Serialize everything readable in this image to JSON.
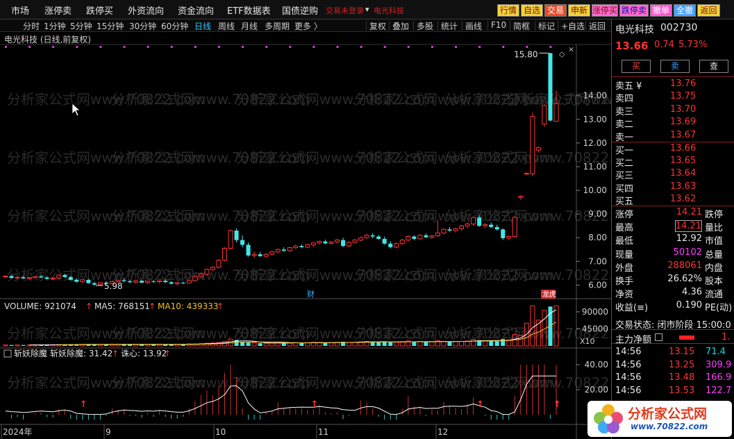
{
  "menu": {
    "items": [
      "市场",
      "涨停卖",
      "跌停买",
      "外资流向",
      "资金流向",
      "ETF数据表",
      "国债逆购"
    ],
    "trade_status": "交易未登录",
    "stock_name": "电光科技",
    "quick_buttons": [
      {
        "label": "行情",
        "bg": "#f2d33a",
        "fg": "#7a1010"
      },
      {
        "label": "自选",
        "bg": "#f2d33a",
        "fg": "#7a1010"
      },
      {
        "label": "交易",
        "bg": "#e84a2a",
        "fg": "#ffffff"
      },
      {
        "label": "申新",
        "bg": "#f2d33a",
        "fg": "#7a1010"
      },
      {
        "label": "涨停买",
        "bg": "#ff6ad0",
        "fg": "#7a1010"
      },
      {
        "label": "跌停卖",
        "bg": "#ff6ad0",
        "fg": "#1010aa"
      },
      {
        "label": "撤单",
        "bg": "#ff5ad2",
        "fg": "#ffffff"
      },
      {
        "label": "全撤",
        "bg": "#4aa0ff",
        "fg": "#ffffff"
      },
      {
        "label": "返回",
        "bg": "#f2d33a",
        "fg": "#7a1010"
      }
    ]
  },
  "toolbar": {
    "periods": [
      "分时",
      "1分钟",
      "5分钟",
      "15分钟",
      "30分钟",
      "60分钟",
      "日线",
      "周线",
      "月线",
      "多周期",
      "更多 〉"
    ],
    "active_period": "日线",
    "tools": [
      "复权",
      "叠加",
      "多股",
      "统计",
      "画线",
      "F10",
      "简框",
      "标记",
      "+自选",
      "返回"
    ]
  },
  "chart_title": "电光科技 (日线,前复权)",
  "chart_data": [
    {
      "type": "candlestick",
      "title": "电光科技 (日线,前复权)",
      "yaxis_ticks": [
        14.0,
        13.0,
        12.0,
        11.0,
        10.0,
        9.0,
        8.0,
        7.0,
        6.0
      ],
      "ylim": [
        5.6,
        15.9
      ],
      "xaxis_labels": [
        "2024年",
        "9",
        "10",
        "11",
        "12"
      ],
      "annotations": {
        "high_label": "15.80",
        "low_label": "5.98",
        "badges": [
          "财",
          "龙虎"
        ]
      },
      "candles": [
        [
          6.35,
          6.4,
          6.3,
          6.38
        ],
        [
          6.38,
          6.42,
          6.28,
          6.3
        ],
        [
          6.3,
          6.36,
          6.24,
          6.33
        ],
        [
          6.33,
          6.38,
          6.26,
          6.28
        ],
        [
          6.28,
          6.34,
          6.2,
          6.31
        ],
        [
          6.31,
          6.4,
          6.26,
          6.36
        ],
        [
          6.36,
          6.42,
          6.3,
          6.32
        ],
        [
          6.32,
          6.38,
          6.24,
          6.26
        ],
        [
          6.26,
          6.34,
          6.2,
          6.3
        ],
        [
          6.3,
          6.46,
          6.26,
          6.42
        ],
        [
          6.42,
          6.48,
          6.3,
          6.34
        ],
        [
          6.34,
          6.38,
          6.18,
          6.22
        ],
        [
          6.22,
          6.28,
          6.1,
          6.14
        ],
        [
          6.14,
          6.26,
          6.08,
          6.22
        ],
        [
          6.22,
          6.26,
          6.06,
          6.08
        ],
        [
          6.08,
          6.14,
          5.98,
          6.02
        ],
        [
          6.02,
          6.12,
          5.98,
          6.1
        ],
        [
          6.1,
          6.16,
          6.02,
          6.06
        ],
        [
          6.06,
          6.18,
          6.04,
          6.14
        ],
        [
          6.14,
          6.24,
          6.1,
          6.2
        ],
        [
          6.2,
          6.3,
          6.12,
          6.16
        ],
        [
          6.16,
          6.22,
          6.08,
          6.12
        ],
        [
          6.12,
          6.2,
          6.06,
          6.18
        ],
        [
          6.18,
          6.22,
          6.08,
          6.1
        ],
        [
          6.1,
          6.18,
          6.04,
          6.16
        ],
        [
          6.16,
          6.22,
          6.1,
          6.14
        ],
        [
          6.14,
          6.2,
          6.06,
          6.18
        ],
        [
          6.18,
          6.24,
          6.1,
          6.12
        ],
        [
          6.12,
          6.16,
          6.02,
          6.06
        ],
        [
          6.06,
          6.12,
          5.98,
          6.1
        ],
        [
          6.1,
          6.14,
          6.04,
          6.08
        ],
        [
          6.08,
          6.22,
          6.06,
          6.18
        ],
        [
          6.18,
          6.4,
          6.14,
          6.36
        ],
        [
          6.36,
          6.5,
          6.3,
          6.46
        ],
        [
          6.46,
          6.7,
          6.4,
          6.66
        ],
        [
          6.66,
          6.8,
          6.58,
          6.75
        ],
        [
          6.75,
          7.1,
          6.7,
          7.05
        ],
        [
          7.05,
          7.6,
          7.0,
          7.55
        ],
        [
          7.55,
          8.35,
          7.5,
          8.3
        ],
        [
          8.3,
          8.4,
          7.8,
          7.9
        ],
        [
          7.9,
          8.1,
          7.6,
          7.7
        ],
        [
          7.7,
          7.8,
          7.2,
          7.25
        ],
        [
          7.25,
          7.4,
          7.15,
          7.3
        ],
        [
          7.3,
          7.4,
          7.2,
          7.22
        ],
        [
          7.22,
          7.35,
          7.15,
          7.3
        ],
        [
          7.3,
          7.45,
          7.25,
          7.4
        ],
        [
          7.4,
          7.55,
          7.35,
          7.5
        ],
        [
          7.5,
          7.6,
          7.4,
          7.45
        ],
        [
          7.45,
          7.62,
          7.4,
          7.58
        ],
        [
          7.58,
          7.7,
          7.52,
          7.65
        ],
        [
          7.65,
          7.72,
          7.55,
          7.6
        ],
        [
          7.6,
          7.74,
          7.55,
          7.7
        ],
        [
          7.7,
          7.82,
          7.6,
          7.78
        ],
        [
          7.78,
          7.88,
          7.7,
          7.84
        ],
        [
          7.84,
          7.92,
          7.72,
          7.76
        ],
        [
          7.76,
          7.86,
          7.7,
          7.82
        ],
        [
          7.82,
          7.95,
          7.75,
          7.9
        ],
        [
          7.9,
          8.0,
          7.6,
          7.65
        ],
        [
          7.65,
          7.85,
          7.6,
          7.8
        ],
        [
          7.8,
          7.95,
          7.75,
          7.9
        ],
        [
          7.9,
          8.05,
          7.85,
          8.0
        ],
        [
          8.0,
          8.15,
          7.95,
          8.1
        ],
        [
          8.1,
          8.2,
          7.98,
          8.05
        ],
        [
          8.05,
          8.12,
          7.92,
          7.95
        ],
        [
          7.95,
          8.05,
          7.7,
          7.75
        ],
        [
          7.75,
          7.85,
          7.55,
          7.6
        ],
        [
          7.6,
          7.8,
          7.55,
          7.75
        ],
        [
          7.75,
          7.95,
          7.7,
          7.9
        ],
        [
          7.9,
          8.1,
          7.85,
          8.05
        ],
        [
          8.05,
          8.1,
          7.9,
          7.95
        ],
        [
          7.95,
          8.15,
          7.92,
          8.1
        ],
        [
          8.1,
          8.18,
          7.98,
          8.02
        ],
        [
          8.02,
          8.12,
          7.95,
          8.08
        ],
        [
          8.08,
          8.75,
          8.05,
          8.2
        ],
        [
          8.2,
          8.4,
          8.15,
          8.35
        ],
        [
          8.35,
          8.45,
          8.25,
          8.3
        ],
        [
          8.3,
          8.42,
          8.22,
          8.38
        ],
        [
          8.38,
          8.55,
          8.3,
          8.5
        ],
        [
          8.5,
          8.65,
          8.4,
          8.58
        ],
        [
          8.58,
          8.9,
          8.5,
          8.85
        ],
        [
          8.85,
          8.95,
          8.45,
          8.5
        ],
        [
          8.5,
          8.62,
          8.4,
          8.55
        ],
        [
          8.55,
          8.65,
          8.4,
          8.45
        ],
        [
          8.45,
          8.55,
          8.3,
          8.35
        ],
        [
          8.35,
          8.4,
          7.9,
          7.98
        ],
        [
          7.98,
          8.1,
          7.9,
          8.05
        ],
        [
          8.05,
          8.9,
          8.0,
          8.86
        ],
        [
          9.7,
          9.8,
          9.6,
          9.75
        ],
        [
          10.7,
          10.75,
          10.65,
          10.72
        ],
        [
          10.7,
          13.3,
          10.6,
          13.12
        ],
        [
          11.7,
          11.85,
          11.6,
          11.8
        ],
        [
          12.8,
          13.65,
          12.7,
          13.58
        ],
        [
          15.8,
          15.8,
          12.92,
          12.95
        ],
        [
          12.92,
          14.21,
          12.92,
          13.66
        ]
      ],
      "volume": {
        "label": "VOLUME: 921074",
        "ma5_label": "MA5: 768151",
        "ma10_label": "MA10: 439333",
        "ticks": [
          90000,
          45000
        ],
        "unit": "X10",
        "values": [
          25,
          25,
          25,
          25,
          25,
          30,
          30,
          30,
          30,
          35,
          40,
          40,
          40,
          40,
          40,
          40,
          40,
          40,
          40,
          40,
          40,
          40,
          40,
          40,
          40,
          40,
          40,
          40,
          40,
          40,
          40,
          55,
          55,
          60,
          70,
          80,
          90,
          120,
          180,
          160,
          110,
          90,
          80,
          75,
          70,
          80,
          85,
          75,
          80,
          90,
          85,
          85,
          95,
          90,
          80,
          85,
          95,
          110,
          90,
          95,
          110,
          120,
          115,
          100,
          110,
          95,
          100,
          115,
          130,
          110,
          115,
          105,
          110,
          135,
          120,
          110,
          115,
          120,
          130,
          170,
          150,
          130,
          135,
          120,
          180,
          160,
          300,
          280,
          600,
          1060,
          680,
          940,
          1040,
          1060
        ]
      },
      "indicator": {
        "name": "斩妖除魔",
        "value_label": "斩妖除魔: 31.42",
        "sub_label": "诛心: 13.92",
        "ticks": [
          40,
          20
        ]
      }
    }
  ],
  "quote": {
    "name": "电光科技",
    "code": "002730",
    "price": "13.66",
    "change": "0.74",
    "pct": "5.73%",
    "buy_label": "买",
    "sell_label": "卖",
    "query_label": "查",
    "asks": [
      {
        "label": "卖五 ¥",
        "price": "13.76"
      },
      {
        "label": "卖四",
        "price": "13.75"
      },
      {
        "label": "卖三",
        "price": "13.70"
      },
      {
        "label": "卖二",
        "price": "13.69"
      },
      {
        "label": "卖一",
        "price": "13.67"
      }
    ],
    "bids": [
      {
        "label": "买一",
        "price": "13.66"
      },
      {
        "label": "买二",
        "price": "13.65"
      },
      {
        "label": "买三",
        "price": "13.64"
      },
      {
        "label": "买四",
        "price": "13.63"
      },
      {
        "label": "买五",
        "price": "13.62"
      }
    ],
    "stats": [
      {
        "label": "涨停",
        "value": "14.21",
        "label2": "跌停"
      },
      {
        "label": "最高",
        "value": "14.21",
        "label2": "量比"
      },
      {
        "label": "最低",
        "value": "12.92",
        "label2": "市值"
      },
      {
        "label": "现量",
        "value": "50102",
        "label2": "总量"
      },
      {
        "label": "外盘",
        "value": "288061",
        "label2": "内盘"
      },
      {
        "label": "换手",
        "value": "26.62%",
        "label2": "股本"
      },
      {
        "label": "净资",
        "value": "4.36",
        "label2": "流通"
      },
      {
        "label": "收益(≡)",
        "value": "0.190",
        "label2": "PE(动)"
      }
    ],
    "trade_state": "交易状态: 闭市阶段 15:00:0",
    "main_flow": "主力净额",
    "main_flow_value": "1.",
    "ticks": [
      {
        "time": "14:56",
        "price": "13.15",
        "vol": "71.4"
      },
      {
        "time": "14:56",
        "price": "13.25",
        "vol": "309.9"
      },
      {
        "time": "14:56",
        "price": "13.48",
        "vol": "166.9"
      },
      {
        "time": "14:56",
        "price": "13.53",
        "vol": "122.7"
      }
    ]
  },
  "logo": {
    "title": "分析家公式网",
    "url": "www.70822.com"
  }
}
